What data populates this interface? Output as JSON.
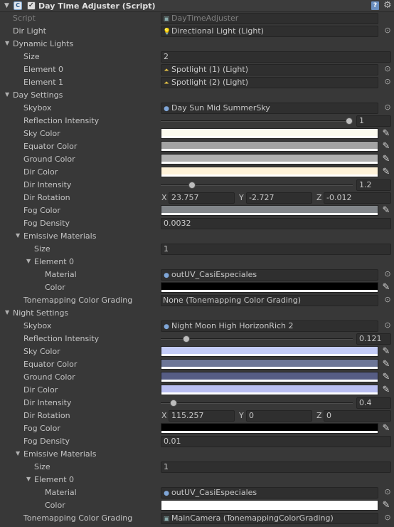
{
  "header": {
    "title": "Day Time Adjuster (Script)",
    "enabled": true,
    "icons": {
      "fold": "foldout-expanded-icon",
      "script": "script-icon",
      "help": "help-book-icon",
      "settings": "gear-icon"
    }
  },
  "script": {
    "label": "Script",
    "value": "DayTimeAdjuster"
  },
  "dir_light": {
    "label": "Dir Light",
    "value": "Directional Light (Light)"
  },
  "dynamic_lights": {
    "label": "Dynamic Lights",
    "size_label": "Size",
    "size": "2",
    "elements": [
      {
        "label": "Element 0",
        "value": "Spotlight (1) (Light)"
      },
      {
        "label": "Element 1",
        "value": "Spotlight (2) (Light)"
      }
    ]
  },
  "day": {
    "label": "Day Settings",
    "skybox": {
      "label": "Skybox",
      "value": "Day Sun Mid SummerSky"
    },
    "reflection": {
      "label": "Reflection Intensity",
      "value": "1",
      "fraction": 1.0
    },
    "sky_color": {
      "label": "Sky Color",
      "color": "#fcfbef"
    },
    "equator_color": {
      "label": "Equator Color",
      "color": "#a3a3a3"
    },
    "ground_color": {
      "label": "Ground Color",
      "color": "#b1b1b1"
    },
    "dir_color": {
      "label": "Dir Color",
      "color": "#fef2d8"
    },
    "dir_intensity": {
      "label": "Dir Intensity",
      "value": "1.2",
      "fraction": 0.15
    },
    "dir_rotation": {
      "label": "Dir Rotation",
      "x_label": "X",
      "x": "23.757",
      "y_label": "Y",
      "y": "-2.727",
      "z_label": "Z",
      "z": "-0.012"
    },
    "fog_color": {
      "label": "Fog Color",
      "color": "#82868a"
    },
    "fog_density": {
      "label": "Fog Density",
      "value": "0.0032"
    },
    "emissive": {
      "label": "Emissive Materials",
      "size_label": "Size",
      "size": "1",
      "element_label": "Element 0",
      "material": {
        "label": "Material",
        "value": "outUV_CasiEspeciales"
      },
      "color": {
        "label": "Color",
        "color": "#000000"
      }
    },
    "tonemapping": {
      "label": "Tonemapping Color Grading",
      "value": "None (Tonemapping Color Grading)"
    }
  },
  "night": {
    "label": "Night Settings",
    "skybox": {
      "label": "Skybox",
      "value": "Night Moon High HorizonRich 2"
    },
    "reflection": {
      "label": "Reflection Intensity",
      "value": "0.121",
      "fraction": 0.121
    },
    "sky_color": {
      "label": "Sky Color",
      "color": "#c4ccf7"
    },
    "equator_color": {
      "label": "Equator Color",
      "color": "#6d7697"
    },
    "ground_color": {
      "label": "Ground Color",
      "color": "#565d85"
    },
    "dir_color": {
      "label": "Dir Color",
      "color": "#babff2"
    },
    "dir_intensity": {
      "label": "Dir Intensity",
      "value": "0.4",
      "fraction": 0.05
    },
    "dir_rotation": {
      "label": "Dir Rotation",
      "x_label": "X",
      "x": "115.257",
      "y_label": "Y",
      "y": "0",
      "z_label": "Z",
      "z": "0"
    },
    "fog_color": {
      "label": "Fog Color",
      "color": "#000000"
    },
    "fog_density": {
      "label": "Fog Density",
      "value": "0.01"
    },
    "emissive": {
      "label": "Emissive Materials",
      "size_label": "Size",
      "size": "1",
      "element_label": "Element 0",
      "material": {
        "label": "Material",
        "value": "outUV_CasiEspeciales"
      },
      "color": {
        "label": "Color",
        "color": "#ffffff"
      }
    },
    "tonemapping": {
      "label": "Tonemapping Color Grading",
      "value": "MainCamera (TonemappingColorGrading)"
    }
  }
}
